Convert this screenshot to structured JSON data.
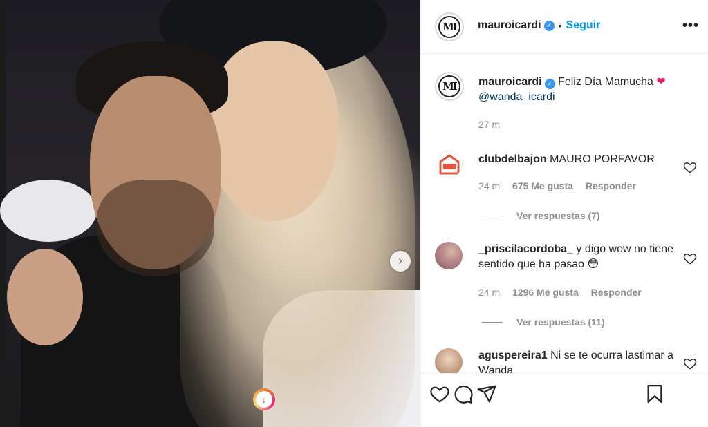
{
  "post": {
    "username": "mauroicardi",
    "follow_label": "Seguir",
    "separator": "•",
    "more_label": "•••",
    "next_glyph": "›",
    "caption": {
      "text": "Feliz Día Mamucha",
      "mention": "@wanda_icardi",
      "time": "27 m"
    }
  },
  "comments": [
    {
      "username": "clubdelbajon",
      "text": "MAURO PORFAVOR",
      "time": "24 m",
      "likes": "675 Me gusta",
      "reply_label": "Responder",
      "view_replies": "Ver respuestas (7)"
    },
    {
      "username": "_priscilacordoba_",
      "text": "y digo wow no tiene sentido que ha pasao 😳",
      "time": "24 m",
      "likes": "1296 Me gusta",
      "reply_label": "Responder",
      "view_replies": "Ver respuestas (11)"
    },
    {
      "username": "aguspereira1",
      "text": "Ni se te ocurra lastimar a Wanda"
    }
  ],
  "icons": {
    "verified": "verified-badge-icon",
    "like": "heart-icon",
    "comment": "comment-icon",
    "share": "paper-plane-icon",
    "save": "bookmark-icon",
    "caption_emoji": "red-heart-icon"
  },
  "colors": {
    "accent": "#0095f6",
    "verified": "#3897f0",
    "muted": "#8e8e8e",
    "heart": "#ed4956"
  }
}
